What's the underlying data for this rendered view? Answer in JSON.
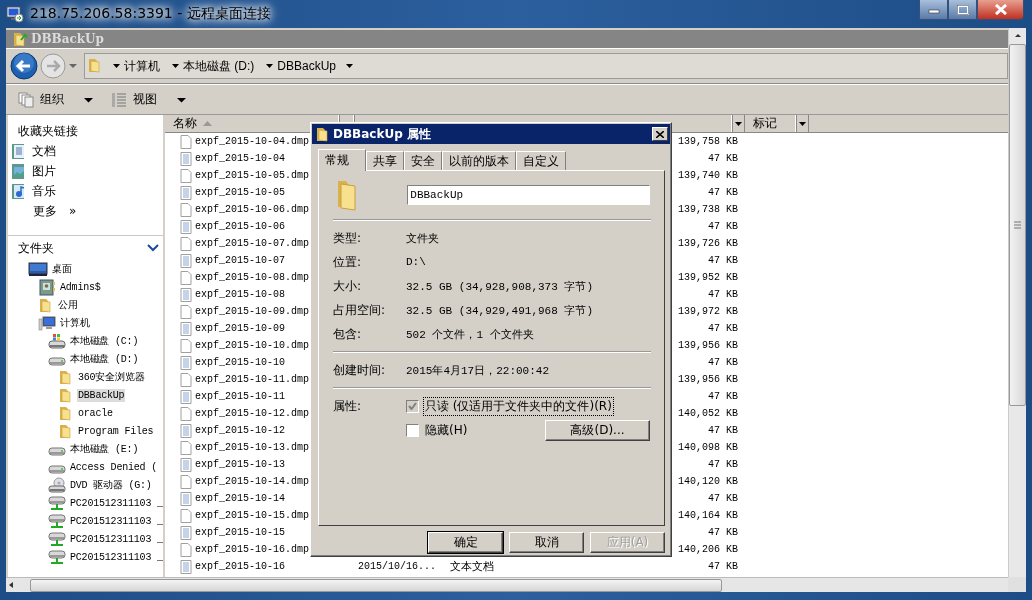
{
  "remote_window": {
    "title": "218.75.206.58:3391 - 远程桌面连接"
  },
  "explorer": {
    "title": "DBBackUp",
    "breadcrumbs": [
      "计算机",
      "本地磁盘 (D:)",
      "DBBackUp"
    ],
    "toolbar": [
      {
        "kind": "organize",
        "label": "组织"
      },
      {
        "kind": "views",
        "label": "视图"
      }
    ]
  },
  "nav": {
    "favorites_title": "收藏夹链接",
    "favorites": [
      {
        "kind": "documents",
        "label": "文档"
      },
      {
        "kind": "pictures",
        "label": "图片"
      },
      {
        "kind": "music",
        "label": "音乐"
      }
    ],
    "more": {
      "label": "更多",
      "glyph": "»"
    },
    "folders_title": "文件夹",
    "tree": [
      {
        "kind": "desktop",
        "label": "桌面",
        "selected": false,
        "children": [
          {
            "kind": "user",
            "label": "Admins$",
            "selected": false
          },
          {
            "kind": "folder",
            "label": "公用",
            "selected": false
          },
          {
            "kind": "computer",
            "label": "计算机",
            "selected": false,
            "children": [
              {
                "kind": "system-drive",
                "label": "本地磁盘 (C:)",
                "selected": false
              },
              {
                "kind": "drive",
                "label": "本地磁盘 (D:)",
                "selected": false,
                "children": [
                  {
                    "kind": "folder",
                    "label": "360安全浏览器",
                    "selected": false
                  },
                  {
                    "kind": "folder",
                    "label": "DBBackUp",
                    "selected": true
                  },
                  {
                    "kind": "folder",
                    "label": "oracle",
                    "selected": false
                  },
                  {
                    "kind": "folder",
                    "label": "Program Files",
                    "selected": false
                  }
                ]
              },
              {
                "kind": "drive",
                "label": "本地磁盘 (E:)",
                "selected": false
              },
              {
                "kind": "drive",
                "label": "Access Denied (",
                "selected": false
              },
              {
                "kind": "dvd",
                "label": "DVD 驱动器 (G:)",
                "selected": false
              },
              {
                "kind": "network",
                "label": "PC201512311103 _",
                "selected": false
              },
              {
                "kind": "network",
                "label": "PC201512311103 _",
                "selected": false
              },
              {
                "kind": "network",
                "label": "PC201512311103 _",
                "selected": false
              },
              {
                "kind": "network",
                "label": "PC201512311103 _",
                "selected": false
              }
            ]
          }
        ]
      }
    ]
  },
  "file_list": {
    "columns": [
      {
        "label": "名称",
        "sorted": true
      },
      {
        "label": "标记",
        "sorted": false
      }
    ],
    "rows": [
      {
        "kind": "dump",
        "name": "expf_2015-10-04.dmp",
        "size": "139,758 KB"
      },
      {
        "kind": "text",
        "name": "expf_2015-10-04",
        "size": "47 KB"
      },
      {
        "kind": "dump",
        "name": "expf_2015-10-05.dmp",
        "size": "139,740 KB"
      },
      {
        "kind": "text",
        "name": "expf_2015-10-05",
        "size": "47 KB"
      },
      {
        "kind": "dump",
        "name": "expf_2015-10-06.dmp",
        "size": "139,738 KB"
      },
      {
        "kind": "text",
        "name": "expf_2015-10-06",
        "size": "47 KB"
      },
      {
        "kind": "dump",
        "name": "expf_2015-10-07.dmp",
        "size": "139,726 KB"
      },
      {
        "kind": "text",
        "name": "expf_2015-10-07",
        "size": "47 KB"
      },
      {
        "kind": "dump",
        "name": "expf_2015-10-08.dmp",
        "size": "139,952 KB"
      },
      {
        "kind": "text",
        "name": "expf_2015-10-08",
        "size": "47 KB"
      },
      {
        "kind": "dump",
        "name": "expf_2015-10-09.dmp",
        "size": "139,972 KB"
      },
      {
        "kind": "text",
        "name": "expf_2015-10-09",
        "size": "47 KB"
      },
      {
        "kind": "dump",
        "name": "expf_2015-10-10.dmp",
        "size": "139,956 KB"
      },
      {
        "kind": "text",
        "name": "expf_2015-10-10",
        "size": "47 KB"
      },
      {
        "kind": "dump",
        "name": "expf_2015-10-11.dmp",
        "size": "139,956 KB"
      },
      {
        "kind": "text",
        "name": "expf_2015-10-11",
        "size": "47 KB"
      },
      {
        "kind": "dump",
        "name": "expf_2015-10-12.dmp",
        "size": "140,052 KB"
      },
      {
        "kind": "text",
        "name": "expf_2015-10-12",
        "size": "47 KB"
      },
      {
        "kind": "dump",
        "name": "expf_2015-10-13.dmp",
        "size": "140,098 KB"
      },
      {
        "kind": "text",
        "name": "expf_2015-10-13",
        "size": "47 KB"
      },
      {
        "kind": "dump",
        "name": "expf_2015-10-14.dmp",
        "size": "140,120 KB"
      },
      {
        "kind": "text",
        "name": "expf_2015-10-14",
        "size": "47 KB"
      },
      {
        "kind": "dump",
        "name": "expf_2015-10-15.dmp",
        "size": "140,164 KB"
      },
      {
        "kind": "text",
        "name": "expf_2015-10-15",
        "size": "47 KB"
      },
      {
        "kind": "dump",
        "name": "expf_2015-10-16.dmp",
        "size": "140,206 KB"
      },
      {
        "kind": "text",
        "name": "expf_2015-10-16",
        "modified": "2015/10/16...",
        "type": "文本文档",
        "size": "47 KB"
      }
    ]
  },
  "dialog": {
    "title": "DBBackUp 属性",
    "tabs": [
      {
        "label": "常规",
        "selected": true
      },
      {
        "label": "共享",
        "selected": false
      },
      {
        "label": "安全",
        "selected": false
      },
      {
        "label": "以前的版本",
        "selected": false
      },
      {
        "label": "自定义",
        "selected": false
      }
    ],
    "name_field": {
      "value": "DBBackUp"
    },
    "sections": [
      [
        {
          "label": "类型:",
          "value": "文件夹"
        },
        {
          "label": "位置:",
          "value": "D:\\"
        },
        {
          "label": "大小:",
          "value": "32.5 GB (34,928,908,373 字节)"
        },
        {
          "label": "占用空间:",
          "value": "32.5 GB (34,929,491,968 字节)"
        },
        {
          "label": "包含:",
          "value": "502 个文件，1 个文件夹"
        }
      ],
      [
        {
          "label": "创建时间:",
          "value": "2015年4月17日，22:00:42"
        }
      ]
    ],
    "attributes_label": "属性:",
    "attributes": [
      {
        "label": "只读 (仅适用于文件夹中的文件)(R)",
        "checked": true,
        "greyed": true,
        "focused": true
      },
      {
        "label": "隐藏(H)",
        "checked": false,
        "greyed": false,
        "focused": false
      }
    ],
    "advanced_button": "高级(D)...",
    "buttons": [
      {
        "label": "确定",
        "default": true,
        "disabled": false
      },
      {
        "label": "取消",
        "default": false,
        "disabled": false
      },
      {
        "label": "应用(A)",
        "default": false,
        "disabled": true
      }
    ]
  }
}
